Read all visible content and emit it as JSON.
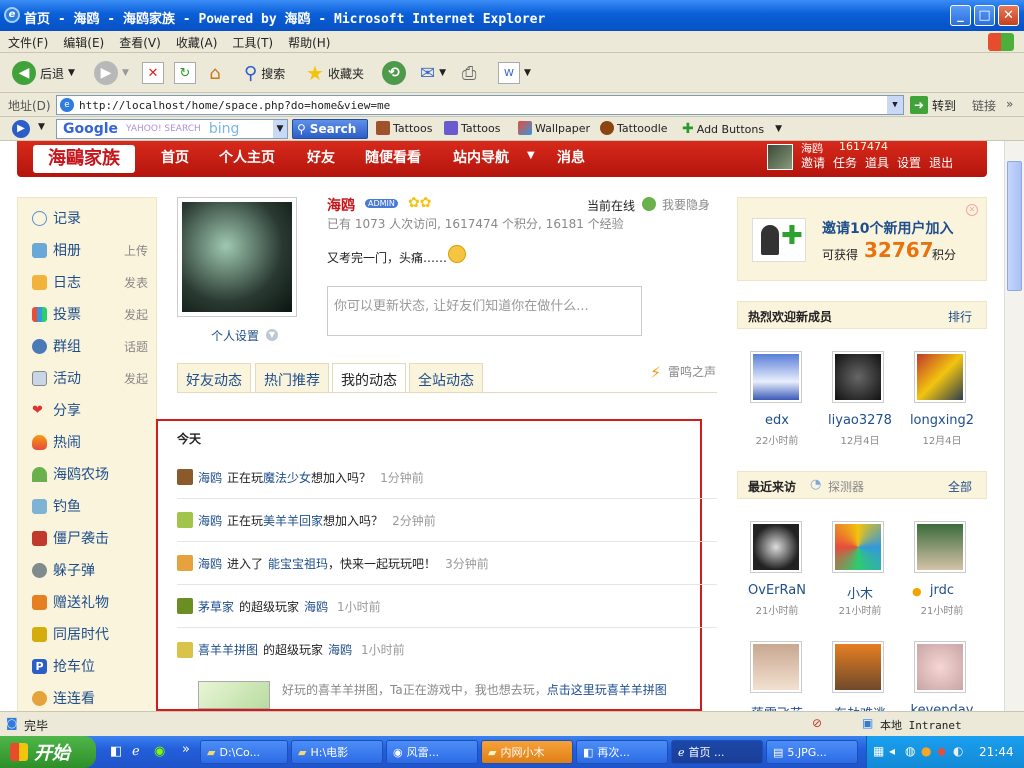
{
  "window": {
    "title": "首页 - 海鸥 - 海鸥家族 - Powered by 海鸥 - Microsoft Internet Explorer"
  },
  "menu": [
    "文件(F)",
    "编辑(E)",
    "查看(V)",
    "收藏(A)",
    "工具(T)",
    "帮助(H)"
  ],
  "toolbar": {
    "back": "后退",
    "search": "搜索",
    "favorites": "收藏夹"
  },
  "address": {
    "label": "地址(D)",
    "url": "http://localhost/home/space.php?do=home&view=me",
    "go": "转到",
    "links": "链接"
  },
  "googlebar": {
    "google": "Google",
    "yahoo": "YAHOO! SEARCH",
    "bing": "bing",
    "search": "Search",
    "items": [
      "Tattoos",
      "Tattoos",
      "Wallpaper",
      "Tattoodle",
      "Add Buttons"
    ]
  },
  "site": {
    "logo": "海鷗家族",
    "nav": [
      "首页",
      "个人主页",
      "好友",
      "随便看看",
      "站内导航",
      "消息"
    ],
    "user_nav": {
      "name": "海鸥",
      "points": "1617474",
      "links": [
        "邀请",
        "任务",
        "道具",
        "设置",
        "退出"
      ]
    }
  },
  "sidebar": [
    {
      "label": "记录",
      "sub": ""
    },
    {
      "label": "相册",
      "sub": "上传"
    },
    {
      "label": "日志",
      "sub": "发表"
    },
    {
      "label": "投票",
      "sub": "发起"
    },
    {
      "label": "群组",
      "sub": "话题"
    },
    {
      "label": "活动",
      "sub": "发起"
    },
    {
      "label": "分享",
      "sub": ""
    },
    {
      "label": "热闹",
      "sub": ""
    },
    {
      "label": "海鸥农场",
      "sub": ""
    },
    {
      "label": "钓鱼",
      "sub": ""
    },
    {
      "label": "僵尸袭击",
      "sub": ""
    },
    {
      "label": "躲子弹",
      "sub": ""
    },
    {
      "label": "赠送礼物",
      "sub": ""
    },
    {
      "label": "同居时代",
      "sub": ""
    },
    {
      "label": "抢车位",
      "sub": ""
    },
    {
      "label": "连连看",
      "sub": ""
    }
  ],
  "profile": {
    "name": "海鸥",
    "badge": "ADMIN",
    "stats": "已有  1073 人次访问, 1617474 个积分, 16181 个经验",
    "online": "当前在线",
    "hide": "我要隐身",
    "status": "又考完一门，头痛……",
    "settings": "个人设置",
    "status_placeholder": "你可以更新状态, 让好友们知道你在做什么..."
  },
  "tabs": [
    "好友动态",
    "热门推荐",
    "我的动态",
    "全站动态"
  ],
  "thunder": "雷鸣之声",
  "feed": {
    "today": "今天",
    "items": [
      {
        "a": "海鸥",
        "b": "正在玩",
        "c": "魔法少女",
        "d": "想加入吗？",
        "time": "1分钟前"
      },
      {
        "a": "海鸥",
        "b": "正在玩",
        "c": "美羊羊回家",
        "d": "想加入吗？",
        "time": "2分钟前"
      },
      {
        "a": "海鸥",
        "b": "进入了",
        "c": "能宝宝祖玛",
        "d": "，快来一起玩玩吧！",
        "time": "3分钟前"
      },
      {
        "a": "茅草家",
        "b": "的超级玩家",
        "c": "海鸥",
        "d": "",
        "time": "1小时前"
      },
      {
        "a": "喜羊羊拼图",
        "b": "的超级玩家",
        "c": "海鸥",
        "d": "",
        "time": "1小时前"
      }
    ],
    "note_text": "好玩的喜羊羊拼图，Ta正在游戏中，我也想去玩，",
    "note_link": "点击这里玩喜羊羊拼图"
  },
  "invite": {
    "title": "邀请10个新用户加入",
    "gain": "可获得",
    "points": "32767",
    "unit": "积分"
  },
  "new_members": {
    "title": "热烈欢迎新成员",
    "more": "排行",
    "users": [
      {
        "name": "edx",
        "time": "22小时前"
      },
      {
        "name": "liyao3278",
        "time": "12月4日"
      },
      {
        "name": "longxing2",
        "time": "12月4日"
      }
    ]
  },
  "visitors": {
    "title": "最近来访",
    "probe": "探测器",
    "more": "全部",
    "users": [
      {
        "name": "OvErRaN",
        "time": "21小时前"
      },
      {
        "name": "小木",
        "time": "21小时前"
      },
      {
        "name": "jrdc",
        "time": "21小时前"
      }
    ],
    "more_users": [
      "落霞飞花",
      "东劫难逃",
      "kevepday"
    ]
  },
  "status": {
    "text": "完毕",
    "zone": "本地 Intranet"
  },
  "taskbar": {
    "start": "开始",
    "tasks": [
      "D:\\Co...",
      "H:\\电影",
      "风雷...",
      "内网小木",
      "再次...",
      "首页 ...",
      "5.JPG..."
    ],
    "time": "21:44"
  },
  "colors": {
    "accent": "#c6161b",
    "link": "#1e4e8c",
    "points": "#e8720c"
  }
}
